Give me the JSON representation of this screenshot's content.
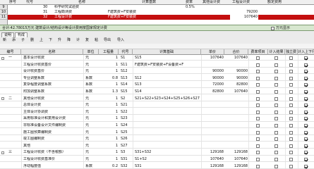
{
  "top_table": {
    "headers": [
      "序号",
      "代号",
      "名称",
      "计算基数",
      "费率",
      "其他设计费",
      "工程设计费",
      "额定费用"
    ],
    "rows": [
      {
        "num": "9",
        "no": "",
        "code": "30",
        "name": "科学研究试验费",
        "base": "",
        "rate": "0.5%",
        "other": "",
        "fee": "",
        "limit": ""
      },
      {
        "num": "10",
        "no": "",
        "code": "31",
        "name": "工程勘测费",
        "base": "F建筑费+F安装费",
        "rate": "",
        "other": "",
        "fee": "79200",
        "limit": ""
      },
      {
        "num": "11",
        "no": "",
        "code": "32",
        "name": "工程设计费",
        "base": "F建筑费+F安装费",
        "rate": "",
        "other": "",
        "fee": "107640",
        "limit": ""
      }
    ]
  },
  "status_bar": {
    "text": "合计:42.78015万元  建筑设计/结构设计等设计费用按国家规定计费",
    "unit_label": "万元显示"
  },
  "tabs": [
    "说明",
    "构成"
  ],
  "toolbar": [
    "新",
    "添",
    "子",
    "删",
    "上",
    "下",
    "升",
    "降",
    "计",
    "复",
    "粘",
    "导出",
    "导入"
  ],
  "grid_headers": [
    "编号",
    "名称",
    "单位",
    "工程量",
    "代号",
    "计算基础",
    "单价",
    "合价",
    "费率项目",
    "计入结果",
    "独立费",
    "计入上下行"
  ],
  "grid_rows": [
    {
      "no": "一",
      "name": "基本设计收费",
      "unit": "元",
      "qty": "1",
      "code": "S1",
      "base": "S15",
      "price": "107640",
      "total": "107640",
      "c1": false,
      "c2": false,
      "c3": false,
      "c4": true
    },
    {
      "no": "",
      "name": "工程设计收费基价",
      "unit": "元",
      "qty": "1",
      "code": "S11",
      "base": "F建筑费+F安装费+F设备费+F",
      "price": "",
      "total": "",
      "c1": false,
      "c2": false,
      "c3": false,
      "c4": true
    },
    {
      "no": "",
      "name": "设计收费基价",
      "unit": "元",
      "qty": "1",
      "code": "S12",
      "base": "",
      "price": "90000",
      "total": "90000",
      "c1": false,
      "c2": false,
      "c3": false,
      "c4": true
    },
    {
      "no": "",
      "name": "专业调整系数",
      "unit": "系数",
      "qty": "0.8",
      "code": "S13",
      "base": "S12",
      "price": "90000",
      "total": "90000",
      "c1": false,
      "c2": false,
      "c3": false,
      "c4": true
    },
    {
      "no": "",
      "name": "复杂程度调整系数",
      "unit": "系数",
      "qty": "1",
      "code": "S14",
      "base": "S13",
      "price": "72000",
      "total": "82800",
      "c1": false,
      "c2": false,
      "c3": false,
      "c4": true
    },
    {
      "no": "",
      "name": "附加调整系数",
      "unit": "系数",
      "qty": "1.3",
      "code": "S15",
      "base": "S14",
      "price": "82800",
      "total": "107640",
      "c1": false,
      "c2": false,
      "c3": false,
      "c4": true
    },
    {
      "no": "二",
      "name": "其他设计收费",
      "unit": "元",
      "qty": "1",
      "code": "S2",
      "base": "S21+S22+S23+S24+S25+S26+S27",
      "price": "",
      "total": "",
      "c1": false,
      "c2": false,
      "c3": false,
      "c4": true
    },
    {
      "no": "",
      "name": "总体设计费",
      "unit": "元",
      "qty": "1",
      "code": "S21",
      "base": "",
      "price": "",
      "total": "",
      "c1": false,
      "c2": false,
      "c3": false,
      "c4": true
    },
    {
      "no": "",
      "name": "主体设计协调费",
      "unit": "元",
      "qty": "1",
      "code": "S22",
      "base": "",
      "price": "",
      "total": "",
      "c1": false,
      "c2": false,
      "c3": false,
      "c4": true
    },
    {
      "no": "",
      "name": "采用标准设计和复用设计费",
      "unit": "元",
      "qty": "1",
      "code": "S23",
      "base": "",
      "price": "",
      "total": "",
      "c1": false,
      "c2": false,
      "c3": false,
      "c4": true
    },
    {
      "no": "",
      "name": "非标准设备设计文件编制费",
      "unit": "元",
      "qty": "1",
      "code": "S24",
      "base": "",
      "price": "",
      "total": "",
      "c1": false,
      "c2": false,
      "c3": false,
      "c4": true
    },
    {
      "no": "",
      "name": "施工图预算编制费",
      "unit": "元",
      "qty": "1",
      "code": "S25",
      "base": "",
      "price": "",
      "total": "",
      "c1": false,
      "c2": false,
      "c3": false,
      "c4": true
    },
    {
      "no": "",
      "name": "竣工图编制费",
      "unit": "元",
      "qty": "1",
      "code": "S26",
      "base": "",
      "price": "",
      "total": "",
      "c1": false,
      "c2": false,
      "c3": false,
      "c4": true
    },
    {
      "no": "",
      "name": "其他",
      "unit": "元",
      "qty": "1",
      "code": "S27",
      "base": "",
      "price": "",
      "total": "",
      "c1": false,
      "c2": false,
      "c3": false,
      "c4": true
    },
    {
      "no": "三",
      "name": "工程设计收费（不含税额）",
      "unit": "元",
      "qty": "1",
      "code": "S3",
      "base": "S31+S32",
      "price": "129168",
      "total": "129168",
      "c1": false,
      "c2": false,
      "c3": false,
      "c4": true
    },
    {
      "no": "",
      "name": "工程设计收费基准价",
      "unit": "元",
      "qty": "1",
      "code": "S31",
      "base": "S1+S2",
      "price": "107640",
      "total": "107640",
      "c1": false,
      "c2": false,
      "c3": false,
      "c4": true
    },
    {
      "no": "",
      "name": "浮动幅度值",
      "unit": "系数",
      "qty": "0.2",
      "code": "S32",
      "base": "S31",
      "price": "129168",
      "total": "129168",
      "c1": false,
      "c2": false,
      "c3": false,
      "c4": true
    }
  ]
}
